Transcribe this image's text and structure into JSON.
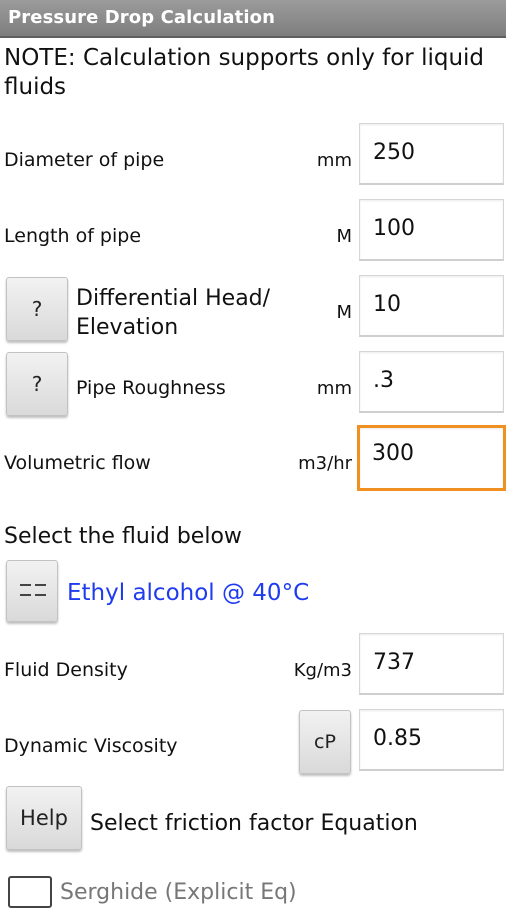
{
  "title": "Pressure Drop Calculation",
  "note": "NOTE: Calculation supports only for liquid fluids",
  "rows": {
    "diameter": {
      "label": "Diameter of pipe",
      "unit": "mm",
      "value": "250"
    },
    "length": {
      "label": "Length of pipe",
      "unit": "M",
      "value": "100"
    },
    "head": {
      "help": "?",
      "label": "Differential Head/ Elevation",
      "unit": "M",
      "value": "10"
    },
    "roughness": {
      "help": "?",
      "label": "Pipe Roughness",
      "unit": "mm",
      "value": ".3"
    },
    "flow": {
      "label": "Volumetric flow",
      "unit": "m3/hr",
      "value": "300"
    },
    "density": {
      "label": "Fluid Density",
      "unit": "Kg/m3",
      "value": "737"
    },
    "viscosity": {
      "label": "Dynamic Viscosity",
      "unit_button": "cP",
      "value": "0.85"
    }
  },
  "fluid": {
    "heading": "Select the fluid below",
    "list_icon": "list-icon",
    "selected": "Ethyl alcohol @ 40°C"
  },
  "friction": {
    "help_label": "Help",
    "label": "Select friction factor Equation",
    "option_label": "Serghide (Explicit Eq)"
  },
  "colors": {
    "titlebar": "#8a8a8a",
    "focus": "#ef9020",
    "link": "#1f3bf0"
  }
}
